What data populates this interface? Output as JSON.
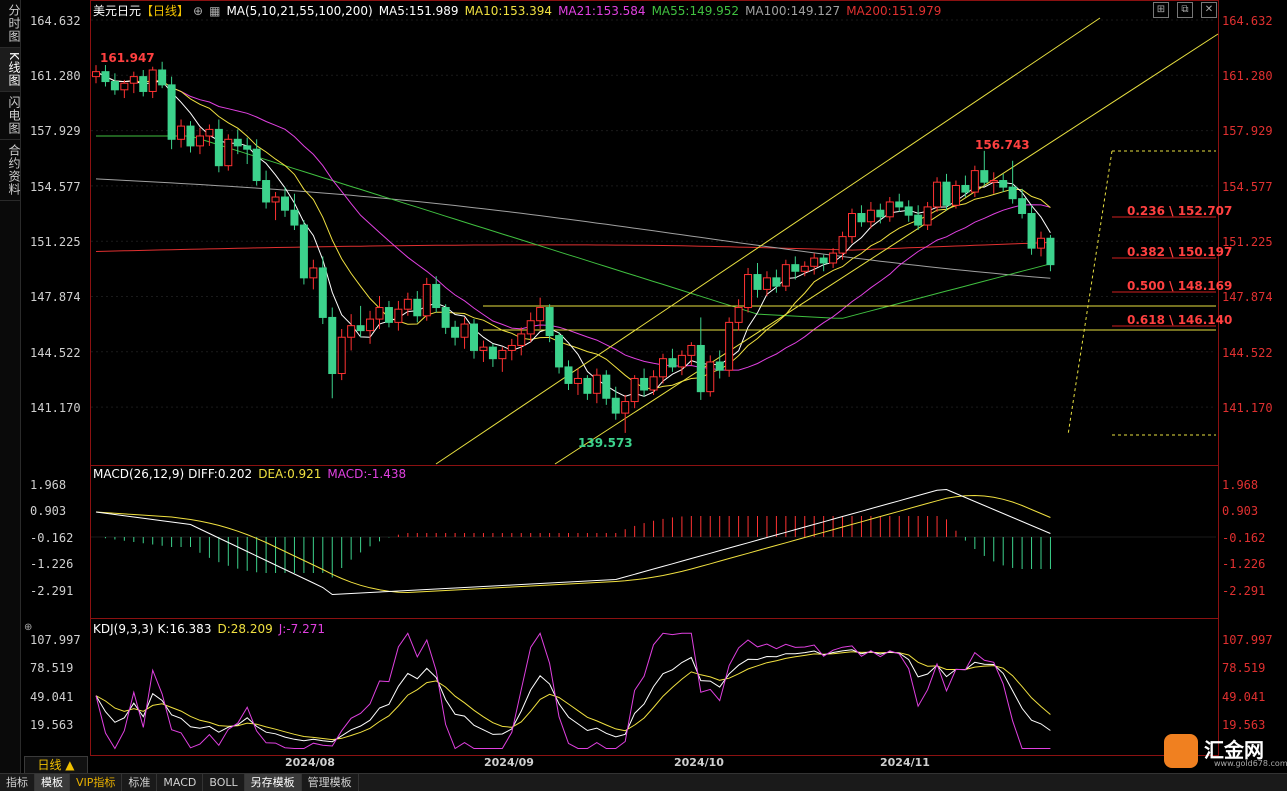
{
  "sidebar": {
    "tabs": [
      "分时图",
      "K线图",
      "闪电图",
      "合约资料"
    ]
  },
  "header": {
    "title": "美元日元",
    "period_tag": "【日线】",
    "ma_label": "MA(5,10,21,55,100,200)",
    "ma5": "MA5:151.989",
    "ma10": "MA10:153.394",
    "ma21": "MA21:153.584",
    "ma55": "MA55:149.952",
    "ma100": "MA100:149.127",
    "ma200": "MA200:151.979"
  },
  "price_axis": [
    "164.632",
    "161.280",
    "157.929",
    "154.577",
    "151.225",
    "147.874",
    "144.522",
    "141.170"
  ],
  "macd": {
    "label": "MACD(26,12,9)",
    "diff": "DIFF:0.202",
    "dea": "DEA:0.921",
    "macd": "MACD:-1.438",
    "axis": [
      "1.968",
      "0.903",
      "-0.162",
      "-1.226",
      "-2.291"
    ]
  },
  "kdj": {
    "label": "KDJ(9,3,3)",
    "k": "K:16.383",
    "d": "D:28.209",
    "j": "J:-7.271",
    "axis": [
      "107.997",
      "78.519",
      "49.041",
      "19.563"
    ]
  },
  "dates": [
    "2024/08",
    "2024/09",
    "2024/10",
    "2024/11"
  ],
  "annotations": {
    "high1": "161.947",
    "low": "139.573",
    "high2": "156.743"
  },
  "fibonacci": [
    "0.236 \\ 152.707",
    "0.382 \\ 150.197",
    "0.500 \\ 148.169",
    "0.618 \\ 146.140"
  ],
  "period_button": "日线 ▲",
  "bottom_tabs": [
    "指标",
    "模板",
    "VIP指标",
    "标准",
    "MACD",
    "BOLL",
    "另存模板",
    "管理模板"
  ],
  "logo": {
    "name": "汇金网",
    "url": "www.gold678.com"
  },
  "colors": {
    "up": "#ff3232",
    "down": "#3cd28c",
    "ma5": "#ffffff",
    "ma10": "#f0e040",
    "ma21": "#e040e0",
    "ma55": "#40c040",
    "ma100": "#a0a0a0",
    "ma200": "#e03030"
  },
  "chart_data": {
    "type": "candlestick",
    "price_axis_range": [
      139.0,
      166.0
    ],
    "x_ticks": [
      "2024/08",
      "2024/09",
      "2024/10",
      "2024/11"
    ],
    "candles": [
      [
        161.2,
        161.9,
        160.8,
        161.5
      ],
      [
        161.5,
        161.9,
        160.6,
        160.9
      ],
      [
        160.9,
        161.4,
        160.1,
        160.4
      ],
      [
        160.4,
        161.0,
        159.9,
        160.8
      ],
      [
        160.8,
        161.5,
        160.2,
        161.2
      ],
      [
        161.2,
        161.6,
        160.0,
        160.3
      ],
      [
        160.3,
        161.8,
        159.9,
        161.6
      ],
      [
        161.6,
        162.1,
        160.5,
        160.7
      ],
      [
        160.7,
        161.2,
        156.8,
        157.4
      ],
      [
        157.4,
        158.6,
        156.9,
        158.2
      ],
      [
        158.2,
        158.5,
        156.6,
        157.0
      ],
      [
        157.0,
        158.1,
        156.5,
        157.6
      ],
      [
        157.6,
        158.3,
        157.0,
        158.0
      ],
      [
        158.0,
        158.6,
        155.4,
        155.8
      ],
      [
        155.8,
        157.7,
        155.5,
        157.4
      ],
      [
        157.4,
        158.0,
        156.5,
        157.0
      ],
      [
        157.0,
        157.5,
        155.9,
        156.8
      ],
      [
        156.8,
        157.4,
        154.6,
        154.9
      ],
      [
        154.9,
        155.5,
        153.2,
        153.6
      ],
      [
        153.6,
        154.2,
        152.5,
        153.9
      ],
      [
        153.9,
        154.5,
        152.7,
        153.1
      ],
      [
        153.1,
        154.1,
        151.9,
        152.2
      ],
      [
        152.2,
        152.5,
        148.6,
        149.0
      ],
      [
        149.0,
        150.1,
        148.3,
        149.6
      ],
      [
        149.6,
        150.3,
        146.2,
        146.6
      ],
      [
        146.6,
        147.2,
        141.7,
        143.2
      ],
      [
        143.2,
        145.9,
        142.8,
        145.4
      ],
      [
        145.4,
        146.8,
        144.6,
        146.1
      ],
      [
        146.1,
        147.3,
        145.4,
        145.8
      ],
      [
        145.8,
        147.0,
        145.0,
        146.5
      ],
      [
        146.5,
        147.9,
        145.9,
        147.2
      ],
      [
        147.2,
        147.6,
        146.0,
        146.3
      ],
      [
        146.3,
        147.6,
        145.8,
        147.1
      ],
      [
        147.1,
        148.1,
        146.7,
        147.7
      ],
      [
        147.7,
        148.2,
        146.3,
        146.7
      ],
      [
        146.7,
        149.0,
        146.4,
        148.6
      ],
      [
        148.6,
        149.1,
        146.9,
        147.2
      ],
      [
        147.2,
        147.4,
        145.6,
        146.0
      ],
      [
        146.0,
        146.4,
        144.9,
        145.4
      ],
      [
        145.4,
        146.6,
        144.7,
        146.2
      ],
      [
        146.2,
        146.5,
        144.1,
        144.6
      ],
      [
        144.6,
        145.2,
        143.9,
        144.8
      ],
      [
        144.8,
        145.0,
        143.6,
        144.1
      ],
      [
        144.1,
        144.8,
        143.3,
        144.6
      ],
      [
        144.6,
        145.3,
        144.0,
        144.9
      ],
      [
        144.9,
        146.0,
        144.3,
        145.6
      ],
      [
        145.6,
        146.9,
        145.1,
        146.4
      ],
      [
        146.4,
        147.8,
        145.9,
        147.2
      ],
      [
        147.2,
        147.4,
        145.1,
        145.5
      ],
      [
        145.5,
        145.7,
        143.2,
        143.6
      ],
      [
        143.6,
        144.0,
        142.2,
        142.6
      ],
      [
        142.6,
        143.5,
        141.9,
        142.9
      ],
      [
        142.9,
        143.1,
        141.6,
        142.0
      ],
      [
        142.0,
        143.5,
        141.4,
        143.1
      ],
      [
        143.1,
        143.4,
        141.3,
        141.7
      ],
      [
        141.7,
        142.4,
        140.4,
        140.8
      ],
      [
        140.8,
        141.9,
        139.6,
        141.5
      ],
      [
        141.5,
        143.1,
        141.1,
        142.9
      ],
      [
        142.9,
        143.5,
        141.8,
        142.2
      ],
      [
        142.2,
        143.4,
        141.9,
        143.0
      ],
      [
        143.0,
        144.4,
        142.6,
        144.1
      ],
      [
        144.1,
        144.7,
        143.3,
        143.6
      ],
      [
        143.6,
        144.6,
        143.1,
        144.3
      ],
      [
        144.3,
        145.1,
        143.7,
        144.9
      ],
      [
        144.9,
        146.6,
        141.6,
        142.1
      ],
      [
        142.1,
        144.3,
        141.8,
        143.9
      ],
      [
        143.9,
        144.6,
        142.9,
        143.4
      ],
      [
        143.4,
        146.6,
        143.0,
        146.3
      ],
      [
        146.3,
        147.7,
        145.8,
        147.2
      ],
      [
        147.2,
        149.6,
        146.9,
        149.2
      ],
      [
        149.2,
        149.9,
        147.8,
        148.3
      ],
      [
        148.3,
        149.4,
        147.9,
        149.0
      ],
      [
        149.0,
        149.5,
        148.1,
        148.5
      ],
      [
        148.5,
        150.1,
        148.2,
        149.8
      ],
      [
        149.8,
        150.3,
        148.9,
        149.4
      ],
      [
        149.4,
        150.0,
        149.1,
        149.7
      ],
      [
        149.7,
        150.5,
        149.2,
        150.2
      ],
      [
        150.2,
        150.4,
        149.4,
        149.9
      ],
      [
        149.9,
        150.8,
        149.6,
        150.5
      ],
      [
        150.5,
        151.8,
        150.1,
        151.5
      ],
      [
        151.5,
        153.2,
        151.1,
        152.9
      ],
      [
        152.9,
        153.4,
        152.1,
        152.4
      ],
      [
        152.4,
        153.6,
        152.0,
        153.1
      ],
      [
        153.1,
        153.5,
        152.3,
        152.7
      ],
      [
        152.7,
        153.9,
        152.4,
        153.6
      ],
      [
        153.6,
        154.1,
        153.0,
        153.3
      ],
      [
        153.3,
        153.7,
        152.4,
        152.8
      ],
      [
        152.8,
        153.4,
        151.9,
        152.2
      ],
      [
        152.2,
        153.6,
        151.9,
        153.3
      ],
      [
        153.3,
        155.1,
        153.0,
        154.8
      ],
      [
        154.8,
        155.3,
        153.1,
        153.4
      ],
      [
        153.4,
        154.9,
        153.2,
        154.6
      ],
      [
        154.6,
        155.2,
        153.9,
        154.2
      ],
      [
        154.2,
        155.8,
        153.9,
        155.5
      ],
      [
        155.5,
        156.7,
        154.6,
        154.8
      ],
      [
        154.8,
        155.4,
        154.1,
        154.9
      ],
      [
        154.9,
        155.3,
        154.2,
        154.5
      ],
      [
        154.5,
        156.1,
        153.5,
        153.8
      ],
      [
        153.8,
        154.4,
        152.6,
        152.9
      ],
      [
        152.9,
        153.4,
        150.4,
        150.8
      ],
      [
        150.8,
        151.8,
        150.3,
        151.4
      ],
      [
        151.4,
        151.6,
        149.4,
        149.8
      ]
    ]
  }
}
